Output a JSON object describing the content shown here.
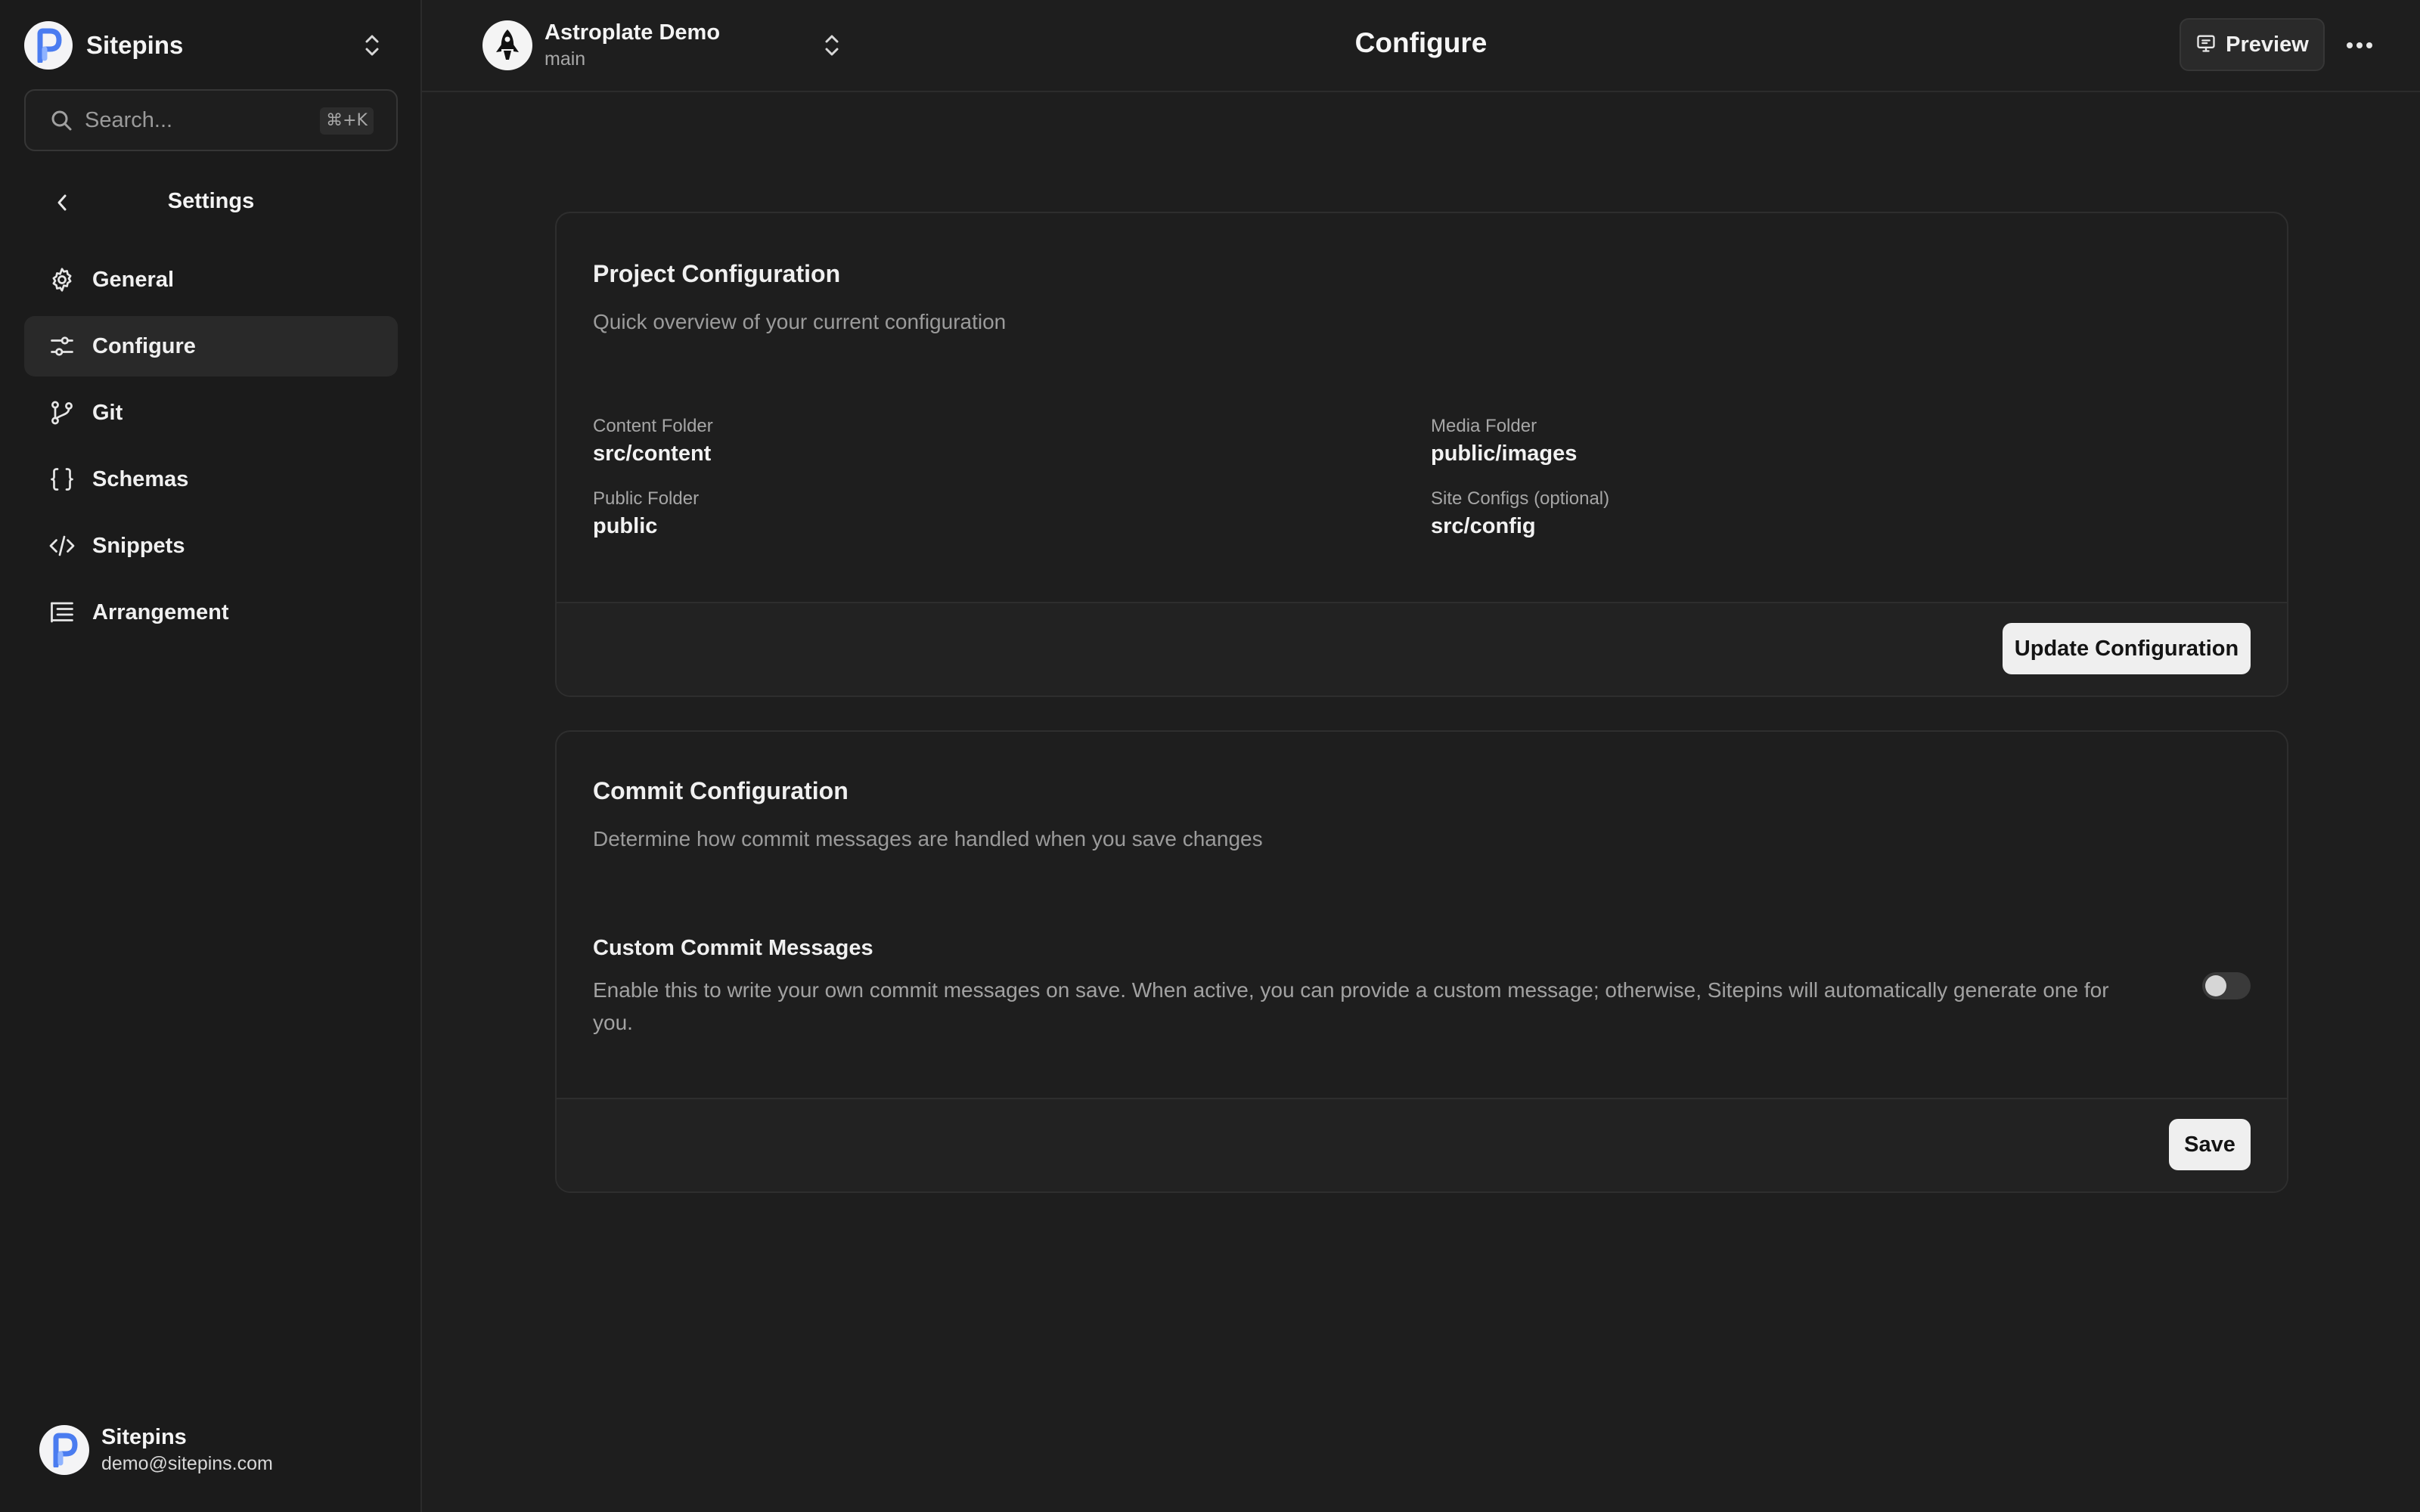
{
  "sidebar": {
    "brand_name": "Sitepins",
    "search": {
      "placeholder": "Search...",
      "shortcut": "⌘+K"
    },
    "settings_title": "Settings",
    "items": [
      {
        "label": "General",
        "icon": "gear-icon"
      },
      {
        "label": "Configure",
        "icon": "sliders-icon",
        "active": true
      },
      {
        "label": "Git",
        "icon": "git-branch-icon"
      },
      {
        "label": "Schemas",
        "icon": "braces-icon"
      },
      {
        "label": "Snippets",
        "icon": "code-icon"
      },
      {
        "label": "Arrangement",
        "icon": "list-tree-icon"
      }
    ],
    "user": {
      "name": "Sitepins",
      "email": "demo@sitepins.com"
    }
  },
  "topbar": {
    "project_name": "Astroplate Demo",
    "branch": "main",
    "title": "Configure",
    "preview_label": "Preview"
  },
  "project_config": {
    "title": "Project Configuration",
    "description": "Quick overview of your current configuration",
    "fields": [
      {
        "label": "Content Folder",
        "value": "src/content"
      },
      {
        "label": "Media Folder",
        "value": "public/images"
      },
      {
        "label": "Public Folder",
        "value": "public"
      },
      {
        "label": "Site Configs (optional)",
        "value": "src/config"
      }
    ],
    "button_label": "Update Configuration"
  },
  "commit_config": {
    "title": "Commit Configuration",
    "description": "Determine how commit messages are handled when you save changes",
    "option_title": "Custom Commit Messages",
    "option_description": "Enable this to write your own commit messages on save. When active, you can provide a custom message; otherwise, Sitepins will automatically generate one for you.",
    "toggle_on": false,
    "button_label": "Save"
  },
  "colors": {
    "background": "#1e1e1e",
    "sidebar": "#1b1b1b",
    "logo_blue": "#4a7cf0",
    "button_light": "#efefef"
  }
}
